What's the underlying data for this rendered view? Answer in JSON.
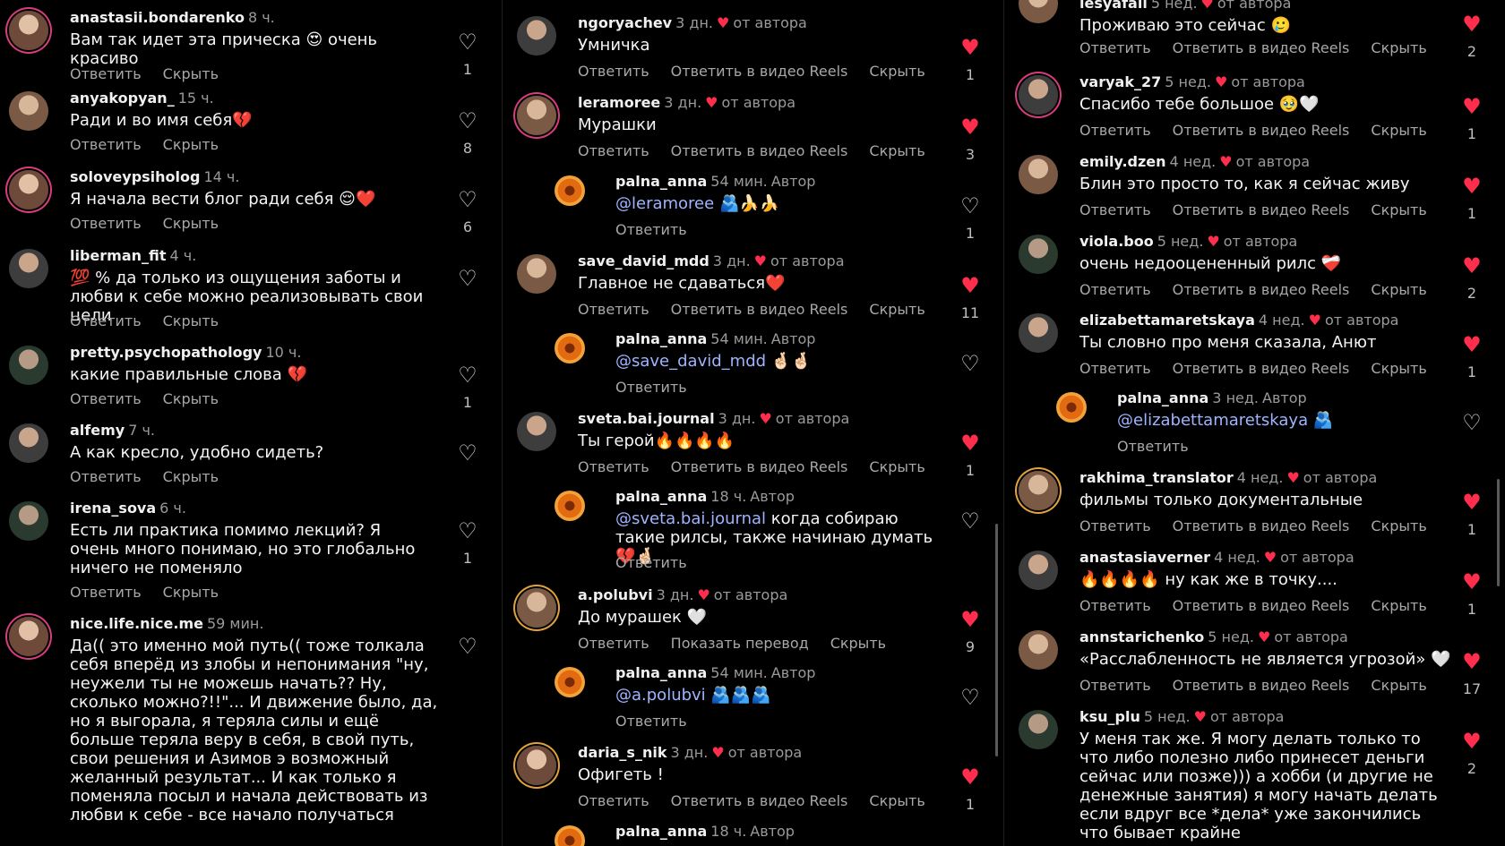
{
  "col1": [
    {
      "user": "anastasii.bondarenko",
      "time": "8 ч.",
      "text": "Вам так идет эта прическа 😍 очень красиво",
      "likes": "1",
      "actions": [
        "Ответить",
        "Скрыть"
      ]
    },
    {
      "user": "anyakopyan_",
      "time": "15 ч.",
      "text": "Ради и во имя себя💔",
      "likes": "8",
      "actions": [
        "Ответить",
        "Скрыть"
      ]
    },
    {
      "user": "soloveypsiholog",
      "time": "14 ч.",
      "text": "Я начала вести блог ради себя 😌❤️",
      "likes": "6",
      "actions": [
        "Ответить",
        "Скрыть"
      ]
    },
    {
      "user": "liberman_fit",
      "time": "4 ч.",
      "text": "💯 % да только из ощущения заботы и любви к себе можно реализовывать свои цели",
      "likes": "",
      "actions": [
        "Ответить",
        "Скрыть"
      ]
    },
    {
      "user": "pretty.psychopathology",
      "time": "10 ч.",
      "text": "какие правильные слова 💔",
      "likes": "1",
      "actions": [
        "Ответить",
        "Скрыть"
      ]
    },
    {
      "user": "alfemy",
      "time": "7 ч.",
      "text": "А как кресло, удобно сидеть?",
      "likes": "",
      "actions": [
        "Ответить",
        "Скрыть"
      ]
    },
    {
      "user": "irena_sova",
      "time": "6 ч.",
      "text": "Есть ли практика помимо лекций? Я очень много понимаю, но это глобально ничего не поменяло",
      "likes": "1",
      "actions": [
        "Ответить",
        "Скрыть"
      ]
    },
    {
      "user": "nice.life.nice.me",
      "time": "59 мин.",
      "text": "Да(( это именно мой путь(( тоже толкала себя вперёд из злобы и непонимания \"ну, неужели ты не можешь начать?? Ну, сколько можно?!!\"... И движение было, да, но я выгорала, я теряла силы и ещё больше теряла веру в себя, в свой путь, свои решения и Азимов э возможный желанный результат... И как только я поменяла посыл и начала действовать из любви к себе - все начало получаться",
      "likes": "",
      "actions": [
        "Ответить",
        "Скрыть"
      ]
    }
  ],
  "col2": [
    {
      "user": "ngoryachev",
      "time": "3 дн.",
      "author": "от автора",
      "text": "Умничка",
      "likes": "1",
      "actions": [
        "Ответить",
        "Ответить в видео Reels",
        "Скрыть"
      ]
    },
    {
      "user": "leramoree",
      "time": "3 дн.",
      "author": "от автора",
      "text": "Мурашки",
      "likes": "3",
      "actions": [
        "Ответить",
        "Ответить в видео Reels",
        "Скрыть"
      ]
    },
    {
      "user": "palna_anna",
      "time": "54 мин.",
      "badge": "Автор",
      "mention": "@leramoree",
      "text": " 🫂🍌🍌",
      "likes": "1",
      "actions": [
        "Ответить"
      ]
    },
    {
      "user": "save_david_mdd",
      "time": "3 дн.",
      "author": "от автора",
      "text": "Главное не сдаваться❤️",
      "likes": "11",
      "actions": [
        "Ответить",
        "Ответить в видео Reels",
        "Скрыть"
      ]
    },
    {
      "user": "palna_anna",
      "time": "54 мин.",
      "badge": "Автор",
      "mention": "@save_david_mdd",
      "text": " 🤞🏻🤞🏻",
      "likes": "",
      "actions": [
        "Ответить"
      ]
    },
    {
      "user": "sveta.bai.journal",
      "time": "3 дн.",
      "author": "от автора",
      "text": "Ты герой🔥🔥🔥🔥",
      "likes": "1",
      "actions": [
        "Ответить",
        "Ответить в видео Reels",
        "Скрыть"
      ]
    },
    {
      "user": "palna_anna",
      "time": "18 ч.",
      "badge": "Автор",
      "mention": "@sveta.bai.journal",
      "text": " когда собираю такие рилсы, также начинаю думать 💔🤞🏻",
      "likes": "",
      "actions": [
        "Ответить"
      ]
    },
    {
      "user": "a.polubvi",
      "time": "3 дн.",
      "author": "от автора",
      "text": "До мурашек 🤍",
      "likes": "9",
      "actions": [
        "Ответить",
        "Показать перевод",
        "Скрыть"
      ]
    },
    {
      "user": "palna_anna",
      "time": "54 мин.",
      "badge": "Автор",
      "mention": "@a.polubvi",
      "text": " 🫂🫂🫂",
      "likes": "",
      "actions": [
        "Ответить"
      ]
    },
    {
      "user": "daria_s_nik",
      "time": "3 дн.",
      "author": "от автора",
      "text": "Офигеть !",
      "likes": "1",
      "actions": [
        "Ответить",
        "Ответить в видео Reels",
        "Скрыть"
      ]
    },
    {
      "user": "palna_anna",
      "time": "18 ч.",
      "badge": "Автор",
      "mention": "",
      "text": "",
      "likes": "",
      "actions": []
    }
  ],
  "col3": [
    {
      "user": "lesyafail",
      "time": "5 нед.",
      "author": "от автора",
      "text": "Проживаю это сейчас 🥲",
      "likes": "2",
      "actions": [
        "Ответить",
        "Ответить в видео Reels",
        "Скрыть"
      ]
    },
    {
      "user": "varyak_27",
      "time": "5 нед.",
      "author": "от автора",
      "text": "Спасибо тебе большое 🥹🤍",
      "likes": "1",
      "actions": [
        "Ответить",
        "Ответить в видео Reels",
        "Скрыть"
      ]
    },
    {
      "user": "emily.dzen",
      "time": "4 нед.",
      "author": "от автора",
      "text": "Блин это просто то, как я сейчас живу",
      "likes": "1",
      "actions": [
        "Ответить",
        "Ответить в видео Reels",
        "Скрыть"
      ]
    },
    {
      "user": "viola.boo",
      "time": "5 нед.",
      "author": "от автора",
      "text": "очень недооцененный рилс ❤️‍🩹",
      "likes": "2",
      "actions": [
        "Ответить",
        "Ответить в видео Reels",
        "Скрыть"
      ]
    },
    {
      "user": "elizabettamaretskaya",
      "time": "4 нед.",
      "author": "от автора",
      "text": "Ты словно про меня сказала, Анют",
      "likes": "1",
      "actions": [
        "Ответить",
        "Ответить в видео Reels",
        "Скрыть"
      ]
    },
    {
      "user": "palna_anna",
      "time": "3 нед.",
      "badge": "Автор",
      "mention": "@elizabettamaretskaya",
      "text": " 🫂",
      "likes": "",
      "actions": [
        "Ответить"
      ]
    },
    {
      "user": "rakhima_translator",
      "time": "4 нед.",
      "author": "от автора",
      "text": "фильмы только документальные",
      "likes": "1",
      "actions": [
        "Ответить",
        "Ответить в видео Reels",
        "Скрыть"
      ]
    },
    {
      "user": "anastasiaverner",
      "time": "4 нед.",
      "author": "от автора",
      "text": "🔥🔥🔥🔥 ну как же в точку....",
      "likes": "1",
      "actions": [
        "Ответить",
        "Ответить в видео Reels",
        "Скрыть"
      ]
    },
    {
      "user": "annstarichenko",
      "time": "5 нед.",
      "author": "от автора",
      "text": "«Расслабленность не является угрозой» 🤍",
      "likes": "17",
      "actions": [
        "Ответить",
        "Ответить в видео Reels",
        "Скрыть"
      ]
    },
    {
      "user": "ksu_plu",
      "time": "5 нед.",
      "author": "от автора",
      "text": "У меня так же. Я могу делать только то что либо полезно либо принесет деньги сейчас или позже))) а хобби (и другие не денежные занятия) я могу начать делать если вдруг все *дела* уже закончились что бывает крайне",
      "likes": "2",
      "actions": []
    }
  ]
}
